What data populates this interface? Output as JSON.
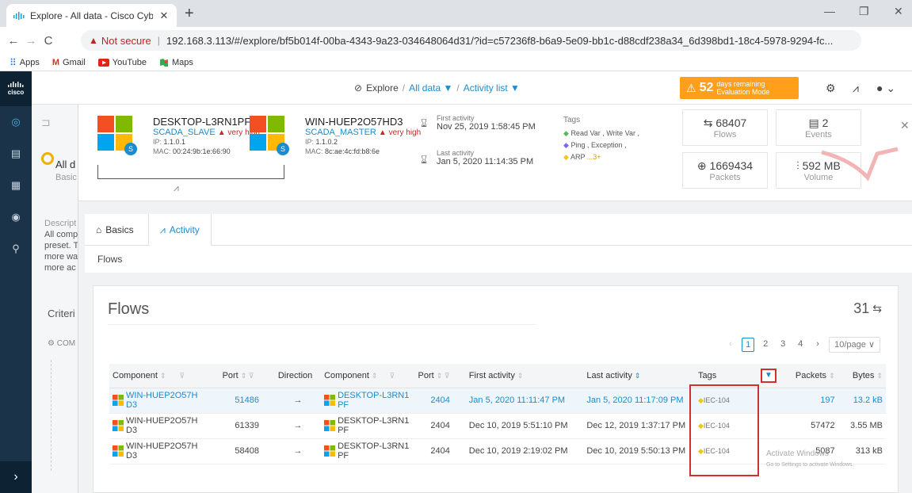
{
  "browser": {
    "tab_title": "Explore - All data - Cisco Cyber V",
    "tab_close": "✕",
    "new_tab": "+",
    "not_secure": "Not secure",
    "url": "192.168.3.113/#/explore/bf5b014f-00ba-4343-9a23-034648064d31/?id=c57236f8-b6a9-5e09-bb1c-d88cdf238a34_6d398bd1-18c4-5978-9294-fc...",
    "bookmarks": [
      {
        "label": "Apps",
        "icon": "apps-grid-icon"
      },
      {
        "label": "Gmail",
        "icon": "gmail-icon"
      },
      {
        "label": "YouTube",
        "icon": "youtube-icon"
      },
      {
        "label": "Maps",
        "icon": "maps-icon"
      }
    ]
  },
  "app": {
    "logo": "cisco",
    "breadcrumb": {
      "explore": "Explore",
      "sep1": "/",
      "all_data": "All data ▼",
      "sep2": "/",
      "activity_list": "Activity list ▼"
    },
    "eval": {
      "count": "52",
      "line1": "days remaining",
      "line2": "Evaluation Mode"
    },
    "colors": {
      "accent": "#1a8ccf",
      "eval": "#ff9f1a",
      "nav": "#1b3349",
      "risk": "#c62828",
      "highlight": "#d32f2f"
    }
  },
  "background": {
    "all_label": "All d",
    "basic_label": "Basic",
    "desc_lines": [
      "Descript",
      "All comp",
      "preset. T",
      "more wa",
      "more ac"
    ],
    "criteria": "Criteri",
    "com": "⚙ COM"
  },
  "activity": {
    "component_a": {
      "name": "DESKTOP-L3RN1PF",
      "role": "SCADA_SLAVE",
      "risk": "▲ very high",
      "ip_label": "IP:",
      "ip": "1.1.0.1",
      "mac_label": "MAC:",
      "mac": "00:24:9b:1e:66:90",
      "badge": "S"
    },
    "component_b": {
      "name": "WIN-HUEP2O57HD3",
      "role": "SCADA_MASTER",
      "risk": "▲ very high",
      "ip_label": "IP:",
      "ip": "1.1.0.2",
      "mac_label": "MAC:",
      "mac": "8c:ae:4c:fd:b8:6e",
      "badge": "S"
    },
    "first_activity_label": "First activity",
    "first_activity": "Nov 25, 2019 1:58:45 PM",
    "last_activity_label": "Last activity",
    "last_activity": "Jan 5, 2020 11:14:35 PM",
    "tags_label": "Tags",
    "tags_line1": "Read Var , Write Var ,",
    "tags_line2": "Ping , Exception ,",
    "tags_line3": "ARP",
    "tags_more": "...3+",
    "stats": [
      {
        "value": "68407",
        "label": "Flows",
        "icon": "flows-icon"
      },
      {
        "value": "2",
        "label": "Events",
        "icon": "calendar-icon"
      },
      {
        "value": "1669434",
        "label": "Packets",
        "icon": "packets-icon"
      },
      {
        "value": "592 MB",
        "label": "Volume",
        "icon": "volume-icon"
      }
    ],
    "close": "✕"
  },
  "tabs": [
    {
      "label": "Basics",
      "icon": "home-icon"
    },
    {
      "label": "Activity",
      "icon": "pulse-icon"
    }
  ],
  "section_label": "Flows",
  "flows": {
    "title": "Flows",
    "count": "31",
    "pages": [
      "‹",
      "1",
      "2",
      "3",
      "4",
      "›"
    ],
    "page_size": "10/page ∨",
    "columns": [
      "Component",
      "Port",
      "Direction",
      "Component",
      "Port",
      "First activity",
      "Last activity",
      "Tags",
      "Packets",
      "Bytes"
    ],
    "rows": [
      {
        "src": "WIN-HUEP2O57H",
        "src2": "D3",
        "sport": "51486",
        "dir": "→",
        "dst": "DESKTOP-L3RN1",
        "dst2": "PF",
        "dport": "2404",
        "first": "Jan 5, 2020 11:11:47 PM",
        "last": "Jan 5, 2020 11:17:09 PM",
        "tag": "IEC-104",
        "packets": "197",
        "bytes": "13.2 kB"
      },
      {
        "src": "WIN-HUEP2O57H",
        "src2": "D3",
        "sport": "61339",
        "dir": "→",
        "dst": "DESKTOP-L3RN1",
        "dst2": "PF",
        "dport": "2404",
        "first": "Dec 10, 2019 5:51:10 PM",
        "last": "Dec 12, 2019 1:37:17 PM",
        "tag": "IEC-104",
        "packets": "57472",
        "bytes": "3.55 MB"
      },
      {
        "src": "WIN-HUEP2O57H",
        "src2": "D3",
        "sport": "58408",
        "dir": "→",
        "dst": "DESKTOP-L3RN1",
        "dst2": "PF",
        "dport": "2404",
        "first": "Dec 10, 2019 2:19:02 PM",
        "last": "Dec 10, 2019 5:50:13 PM",
        "tag": "IEC-104",
        "packets": "5087",
        "bytes": "313 kB"
      }
    ]
  },
  "watermark": {
    "line1": "Activate Windows",
    "line2": "Go to Settings to activate Windows."
  }
}
